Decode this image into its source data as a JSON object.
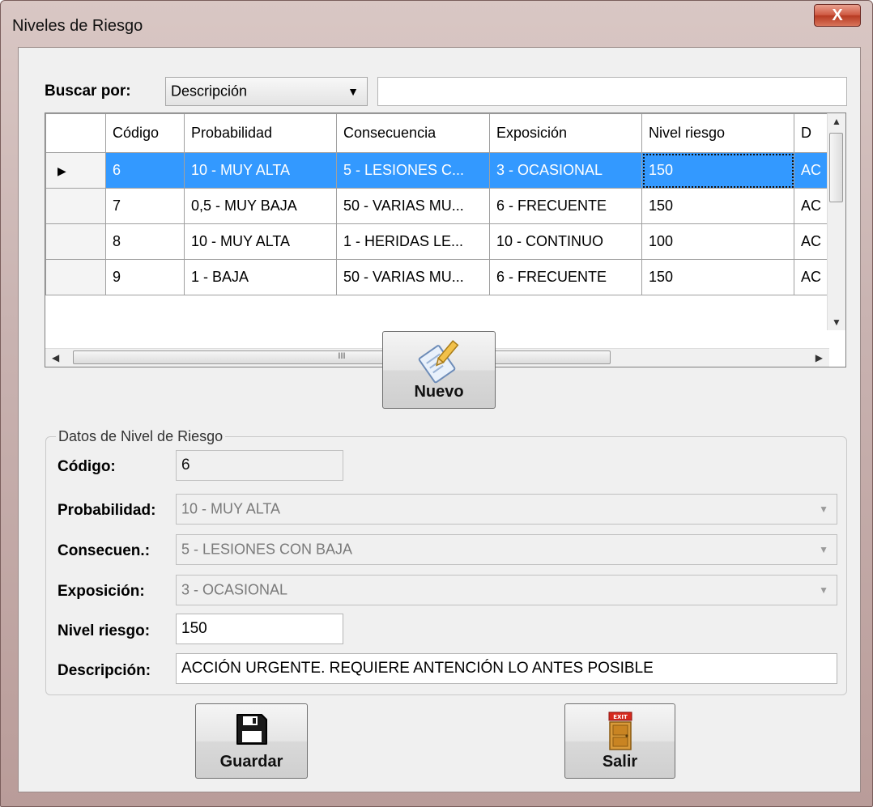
{
  "window": {
    "title": "Niveles de Riesgo",
    "close": "X"
  },
  "search": {
    "label": "Buscar por:",
    "field": "Descripción",
    "text": ""
  },
  "grid": {
    "headers": [
      "Código",
      "Probabilidad",
      "Consecuencia",
      "Exposición",
      "Nivel riesgo",
      "D"
    ],
    "rows": [
      [
        "6",
        "10 - MUY ALTA",
        "5 - LESIONES C...",
        "3 - OCASIONAL",
        "150",
        "AC"
      ],
      [
        "7",
        "0,5 - MUY BAJA",
        "50 - VARIAS MU...",
        "6 - FRECUENTE",
        "150",
        "AC"
      ],
      [
        "8",
        "10 - MUY ALTA",
        "1 - HERIDAS LE...",
        "10 - CONTINUO",
        "100",
        "AC"
      ],
      [
        "9",
        "1 - BAJA",
        "50 - VARIAS MU...",
        "6 - FRECUENTE",
        "150",
        "AC"
      ]
    ],
    "selected_row": 0,
    "hscroll_glyph": "III"
  },
  "buttons": {
    "nuevo": "Nuevo",
    "guardar": "Guardar",
    "salir": "Salir",
    "exit_sign": "EXIT"
  },
  "form": {
    "group_title": "Datos de Nivel de Riesgo",
    "codigo": {
      "label": "Código:",
      "value": "6"
    },
    "probabilidad": {
      "label": "Probabilidad:",
      "value": "10 - MUY ALTA"
    },
    "consecuencia": {
      "label": "Consecuen.:",
      "value": "5 - LESIONES CON BAJA"
    },
    "exposicion": {
      "label": "Exposición:",
      "value": "3 - OCASIONAL"
    },
    "nivel": {
      "label": "Nivel riesgo:",
      "value": "150"
    },
    "descripcion": {
      "label": "Descripción:",
      "value": "ACCIÓN URGENTE. REQUIERE ANTENCIÓN LO ANTES POSIBLE"
    }
  },
  "colors": {
    "selection": "#3399ff",
    "close_button": "#cf5a43"
  },
  "icons": {
    "nuevo": "pencil-document-icon",
    "guardar": "floppy-disk-icon",
    "salir": "exit-door-icon"
  }
}
